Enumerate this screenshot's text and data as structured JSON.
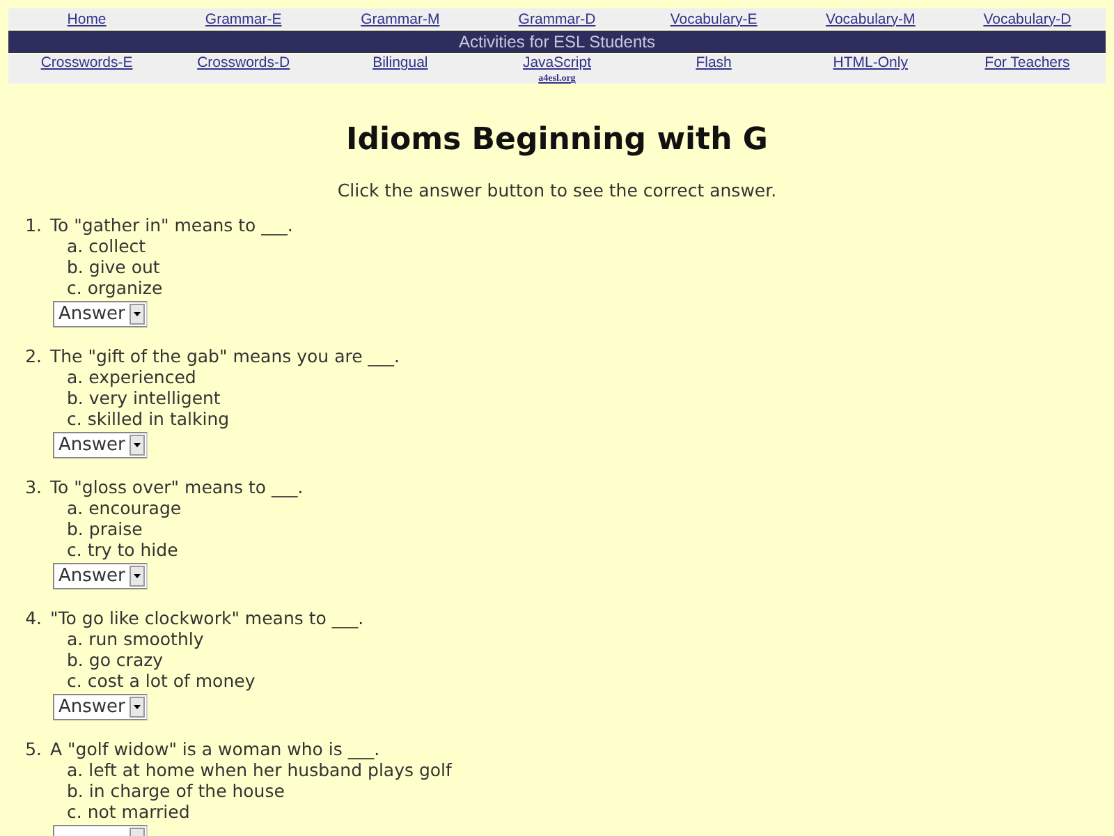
{
  "nav_top": [
    "Home",
    "Grammar-E",
    "Grammar-M",
    "Grammar-D",
    "Vocabulary-E",
    "Vocabulary-M",
    "Vocabulary-D"
  ],
  "banner": "Activities for ESL Students",
  "nav_bottom": [
    "Crosswords-E",
    "Crosswords-D",
    "Bilingual",
    "JavaScript",
    "Flash",
    "HTML-Only",
    "For Teachers"
  ],
  "site_link": "a4esl.org",
  "title": "Idioms Beginning with G",
  "instruction": "Click the answer button to see the correct answer.",
  "questions": [
    {
      "number": "1.",
      "text": "To \"gather in\" means to ___.",
      "options": [
        "a. collect",
        "b. give out",
        "c. organize"
      ],
      "answer": "Answer"
    },
    {
      "number": "2.",
      "text": "The \"gift of the gab\" means you are ___.",
      "options": [
        "a. experienced",
        "b. very intelligent",
        "c. skilled in talking"
      ],
      "answer": "Answer"
    },
    {
      "number": "3.",
      "text": "To \"gloss over\" means to ___.",
      "options": [
        "a. encourage",
        "b. praise",
        "c. try to hide"
      ],
      "answer": "Answer"
    },
    {
      "number": "4.",
      "text": "\"To go like clockwork\" means to ___.",
      "options": [
        "a. run smoothly",
        "b. go crazy",
        "c. cost a lot of money"
      ],
      "answer": "Answer"
    },
    {
      "number": "5.",
      "text": "A \"golf widow\" is a woman who is ___.",
      "options": [
        "a. left at home when her husband plays golf",
        "b. in charge of the house",
        "c. not married"
      ]
    }
  ]
}
